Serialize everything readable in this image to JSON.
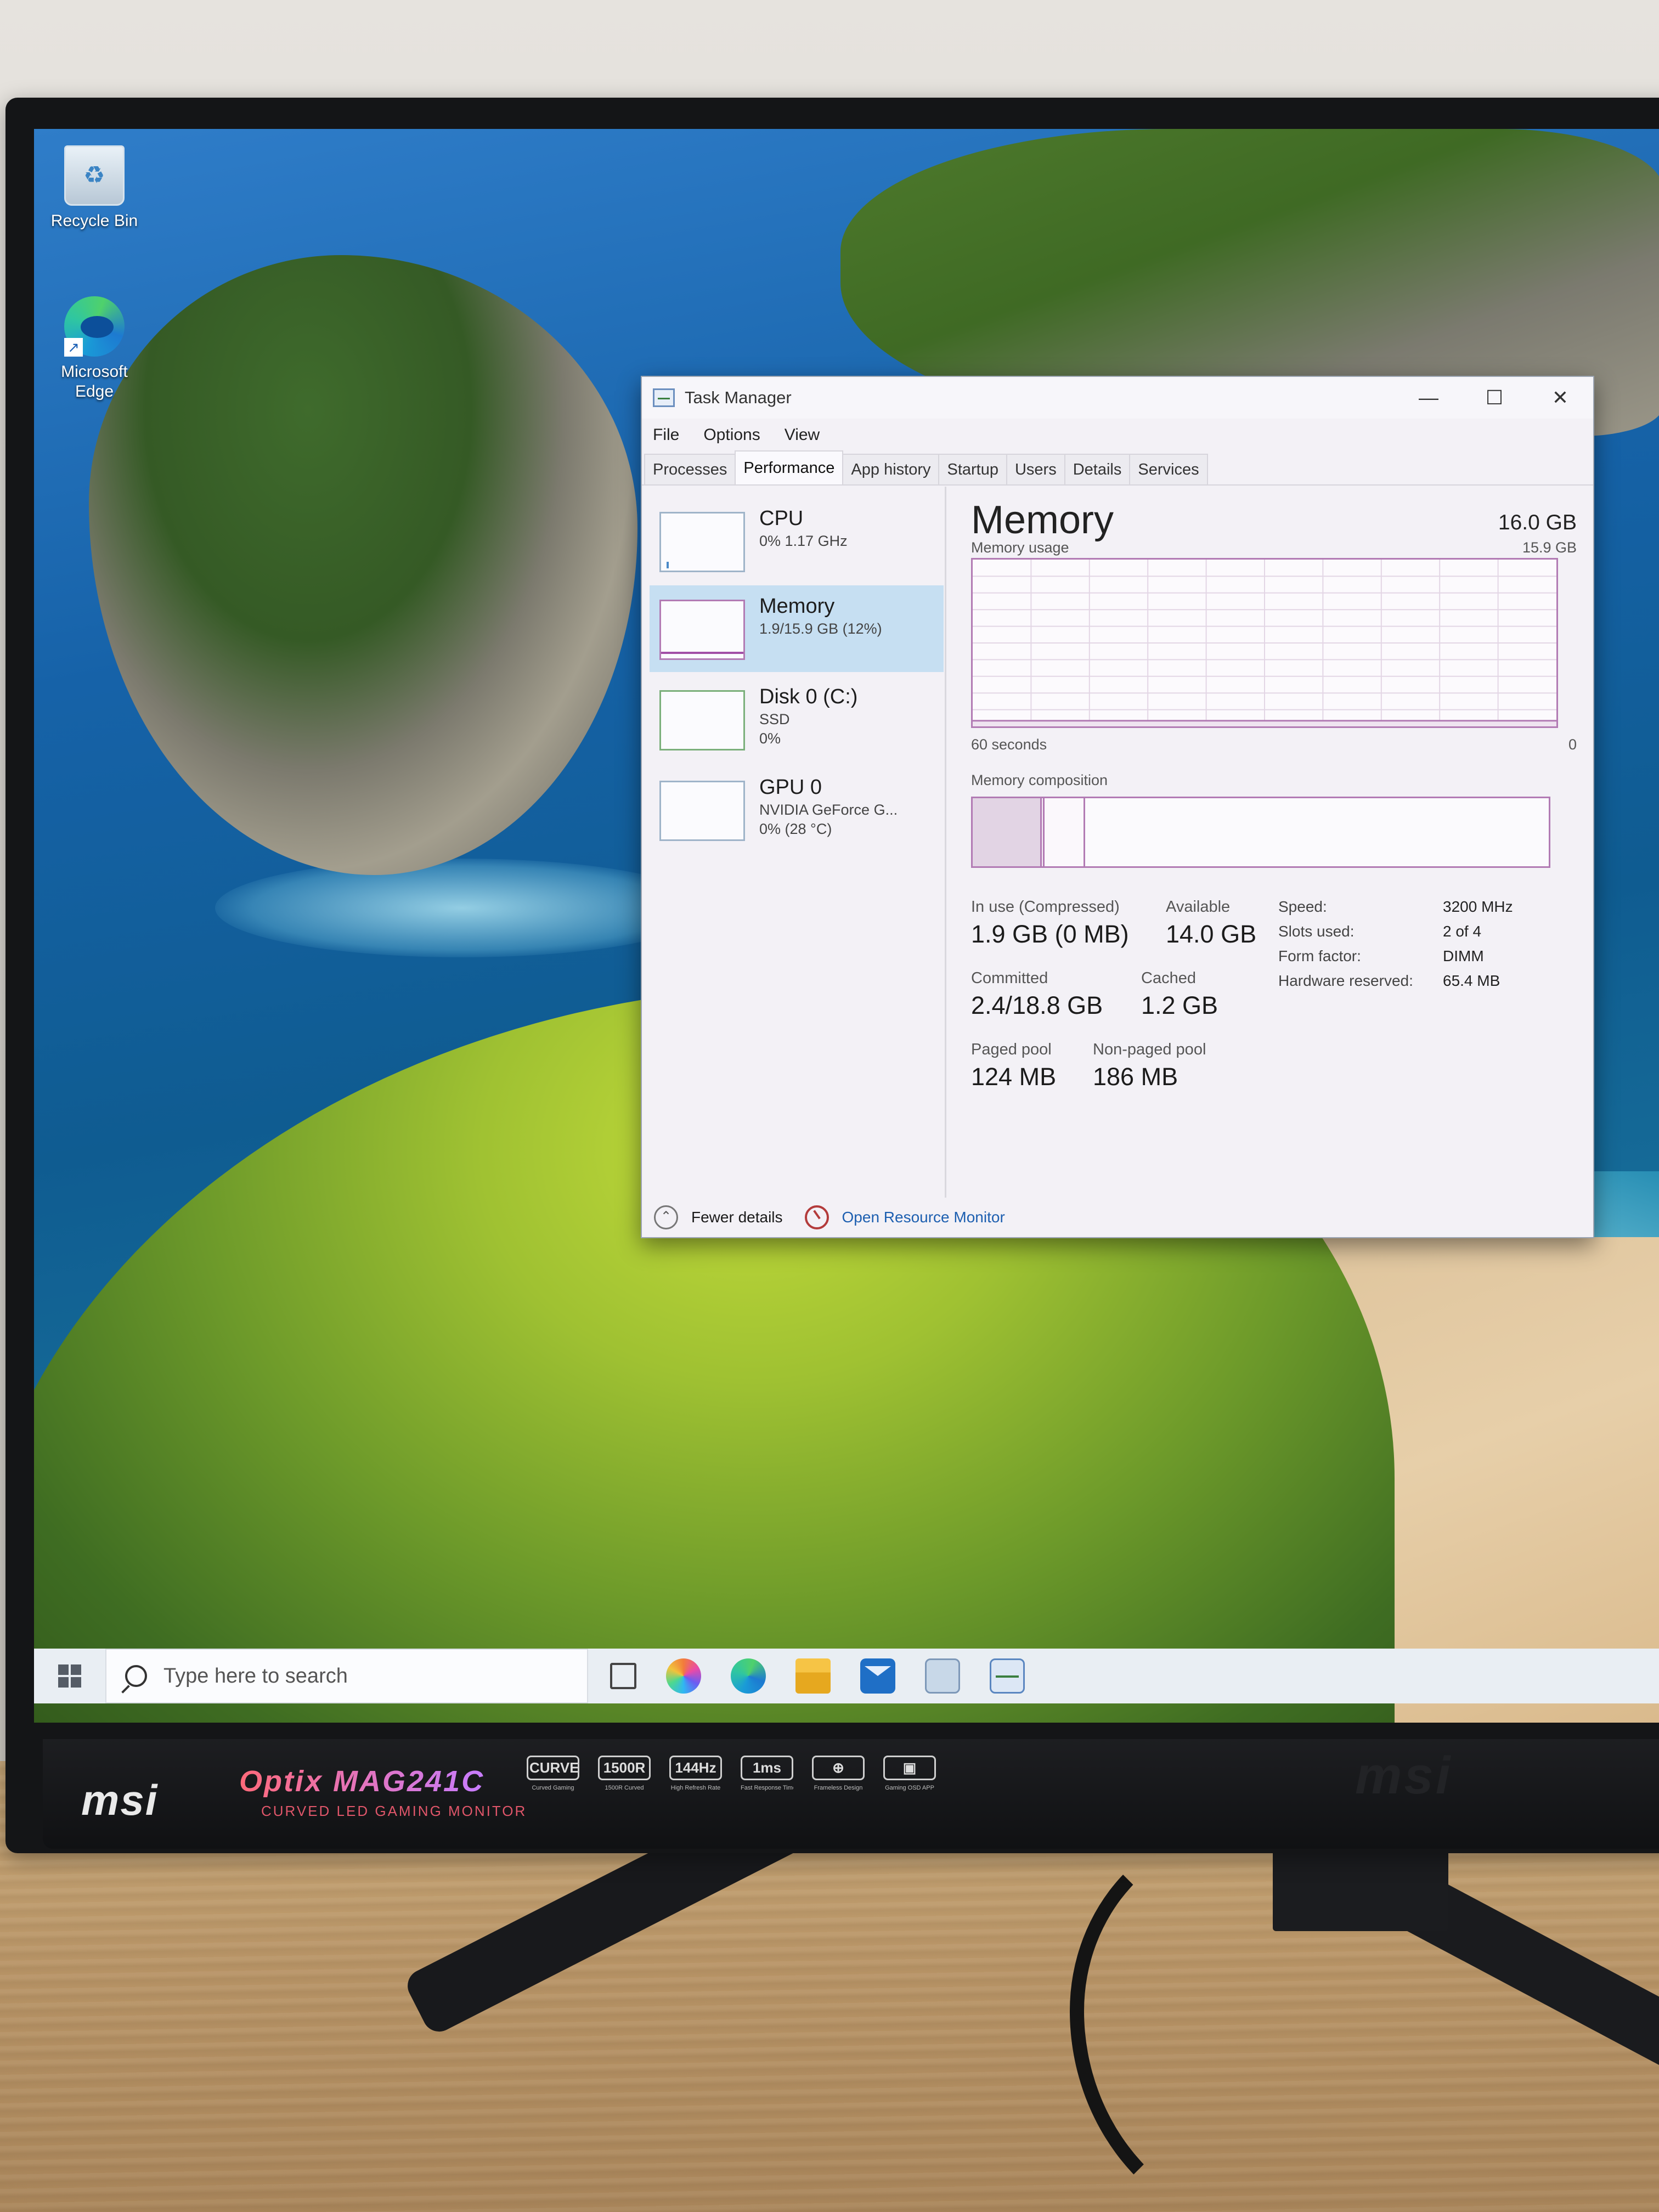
{
  "desktop": {
    "icons": [
      {
        "label": "Recycle Bin",
        "icon": "recycle-bin-icon"
      },
      {
        "label": "Microsoft Edge",
        "icon": "edge-icon"
      }
    ]
  },
  "task_manager": {
    "title": "Task Manager",
    "menu": [
      "File",
      "Options",
      "View"
    ],
    "tabs": [
      "Processes",
      "Performance",
      "App history",
      "Startup",
      "Users",
      "Details",
      "Services"
    ],
    "active_tab": "Performance",
    "sidebar": [
      {
        "name": "CPU",
        "sub1": "0% 1.17 GHz",
        "sub2": ""
      },
      {
        "name": "Memory",
        "sub1": "1.9/15.9 GB (12%)",
        "sub2": ""
      },
      {
        "name": "Disk 0 (C:)",
        "sub1": "SSD",
        "sub2": "0%"
      },
      {
        "name": "GPU 0",
        "sub1": "NVIDIA GeForce G...",
        "sub2": "0% (28 °C)"
      }
    ],
    "selected_item": "Memory",
    "memory": {
      "title": "Memory",
      "total": "16.0 GB",
      "usage_label": "Memory usage",
      "usage_max": "15.9 GB",
      "time_left": "60 seconds",
      "time_right": "0",
      "usage_fraction": 0.12,
      "composition_label": "Memory composition",
      "composition": {
        "in_use": 0.12,
        "modified": 0.005,
        "standby": 0.07
      },
      "stats": {
        "in_use_label": "In use (Compressed)",
        "in_use": "1.9 GB (0 MB)",
        "available_label": "Available",
        "available": "14.0 GB",
        "committed_label": "Committed",
        "committed": "2.4/18.8 GB",
        "cached_label": "Cached",
        "cached": "1.2 GB",
        "paged_label": "Paged pool",
        "paged": "124 MB",
        "nonpaged_label": "Non-paged pool",
        "nonpaged": "186 MB"
      },
      "specs": [
        {
          "label": "Speed:",
          "value": "3200 MHz"
        },
        {
          "label": "Slots used:",
          "value": "2 of 4"
        },
        {
          "label": "Form factor:",
          "value": "DIMM"
        },
        {
          "label": "Hardware reserved:",
          "value": "65.4 MB"
        }
      ]
    },
    "footer": {
      "fewer_details": "Fewer details",
      "open_resource_monitor": "Open Resource Monitor"
    },
    "colors": {
      "memory_accent": "#b27bb4",
      "selected_bg": "#c6dff2",
      "link": "#1d5fb0"
    }
  },
  "taskbar": {
    "search_placeholder": "Type here to search",
    "pinned": [
      "task-view-icon",
      "copilot-icon",
      "edge-icon",
      "file-explorer-icon",
      "mail-icon",
      "photos-icon",
      "task-manager-icon"
    ]
  },
  "monitor": {
    "brand": "msi",
    "model": "Optix MAG241C",
    "subtitle": "CURVED LED GAMING MONITOR",
    "badges": [
      {
        "top": "CURVED",
        "bottom": "Curved Gaming"
      },
      {
        "top": "1500R",
        "bottom": "1500R Curved"
      },
      {
        "top": "144Hz",
        "bottom": "High Refresh Rate"
      },
      {
        "top": "1ms",
        "bottom": "Fast Response Time"
      },
      {
        "top": "⊕",
        "bottom": "Frameless Design"
      },
      {
        "top": "▣",
        "bottom": "Gaming OSD APP"
      }
    ],
    "brand_right": "msi"
  }
}
